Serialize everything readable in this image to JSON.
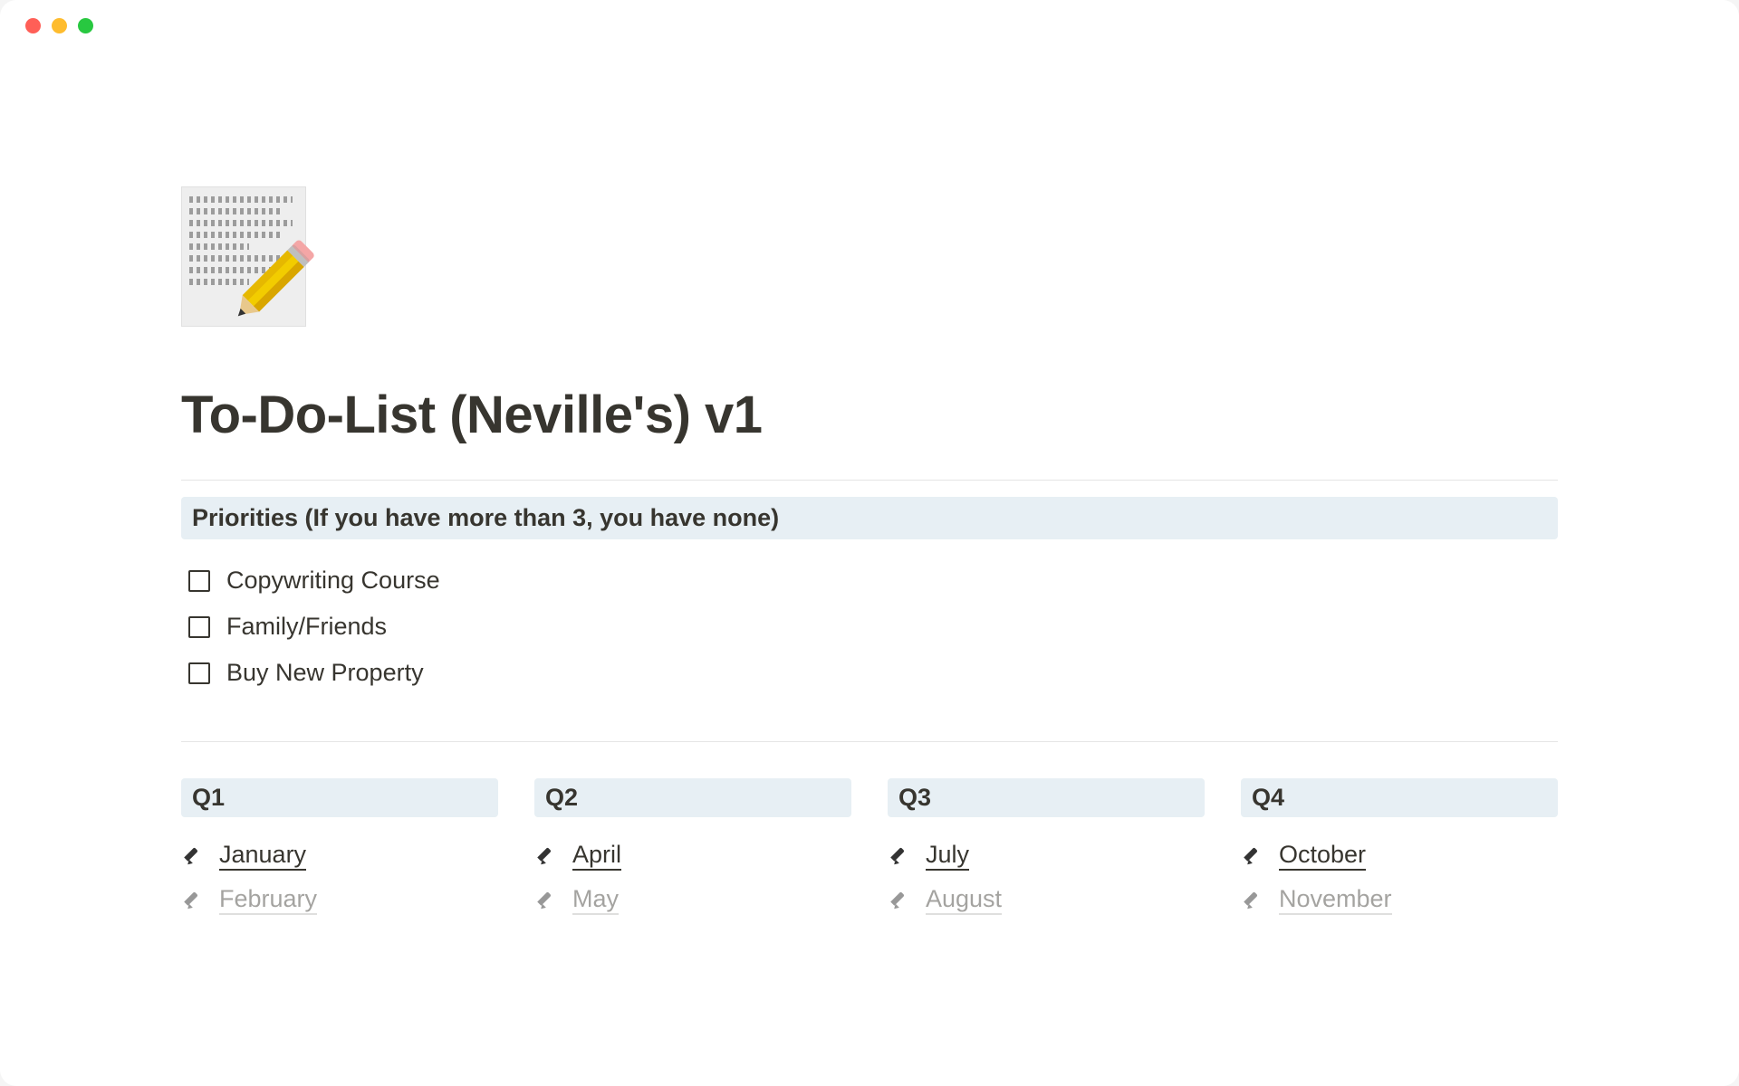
{
  "page": {
    "title": "To-Do-List (Neville's) v1",
    "icon_name": "memo-pencil-icon"
  },
  "priorities": {
    "heading": "Priorities (If you have more than 3, you have none)",
    "items": [
      {
        "label": "Copywriting Course",
        "checked": false
      },
      {
        "label": "Family/Friends",
        "checked": false
      },
      {
        "label": "Buy New Property",
        "checked": false
      }
    ]
  },
  "quarters": [
    {
      "label": "Q1",
      "months": [
        {
          "label": "January",
          "faded": false
        },
        {
          "label": "February",
          "faded": true
        }
      ]
    },
    {
      "label": "Q2",
      "months": [
        {
          "label": "April",
          "faded": false
        },
        {
          "label": "May",
          "faded": true
        }
      ]
    },
    {
      "label": "Q3",
      "months": [
        {
          "label": "July",
          "faded": false
        },
        {
          "label": "August",
          "faded": true
        }
      ]
    },
    {
      "label": "Q4",
      "months": [
        {
          "label": "October",
          "faded": false
        },
        {
          "label": "November",
          "faded": true
        }
      ]
    }
  ]
}
